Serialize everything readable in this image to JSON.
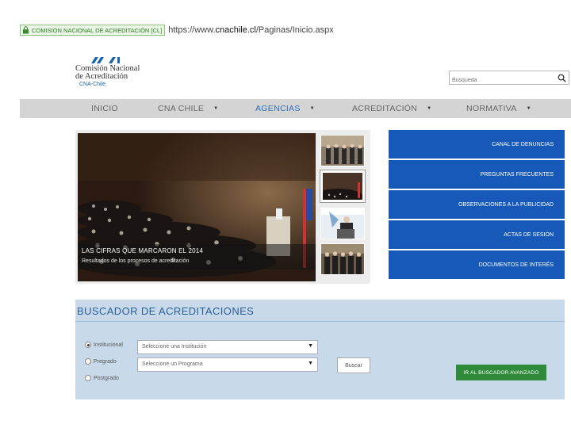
{
  "browser": {
    "cert_label": "COMISION NACIONAL DE ACREDITACIÓN [CL]",
    "url_prefix": "https://www.",
    "url_domain": "cnachile.cl",
    "url_path": "/Paginas/Inicio.aspx"
  },
  "logo": {
    "line1": "Comisión Nacional",
    "line2": "de Acreditación",
    "sub": "CNA-Chile"
  },
  "search": {
    "placeholder": "Búsqueda"
  },
  "nav": {
    "items": [
      {
        "label": "INICIO"
      },
      {
        "label": "CNA CHILE"
      },
      {
        "label": "AGENCIAS"
      },
      {
        "label": "ACREDITACIÓN"
      },
      {
        "label": "NORMATIVA"
      }
    ]
  },
  "slider": {
    "caption_title": "LAS CIFRAS QUE MARCARON EL 2014",
    "caption_sub": "Resultados de los procesos de acreditación"
  },
  "side_buttons": [
    {
      "label": "CANAL DE DENUNCIAS"
    },
    {
      "label": "PREGUNTAS FRECUENTES"
    },
    {
      "label": "OBSERVACIONES A LA PUBLICIDAD"
    },
    {
      "label": "ACTAS DE SESIÓN"
    },
    {
      "label": "DOCUMENTOS DE INTERÉS"
    }
  ],
  "buscador": {
    "title": "BUSCADOR DE ACREDITACIONES",
    "radios": [
      {
        "label": "Institucional",
        "selected": true
      },
      {
        "label": "Pregrado",
        "selected": false
      },
      {
        "label": "Postgrado",
        "selected": false
      }
    ],
    "select_institucion": "Seleccione una Institución",
    "select_programa": "Seleccione un Programa",
    "buscar_label": "Buscar",
    "avanzado_label": "IR AL BUSCADOR AVANZADO"
  },
  "colors": {
    "nav_bg": "#d4d4d4",
    "nav_active": "#2a72c0",
    "side_button_bg": "#1659b8",
    "panel_bg": "#c8daea",
    "advanced_button_bg": "#2f8a3a"
  },
  "icons": {
    "lock": "lock-icon",
    "search": "search-icon",
    "chevron": "chevron-down-icon"
  }
}
